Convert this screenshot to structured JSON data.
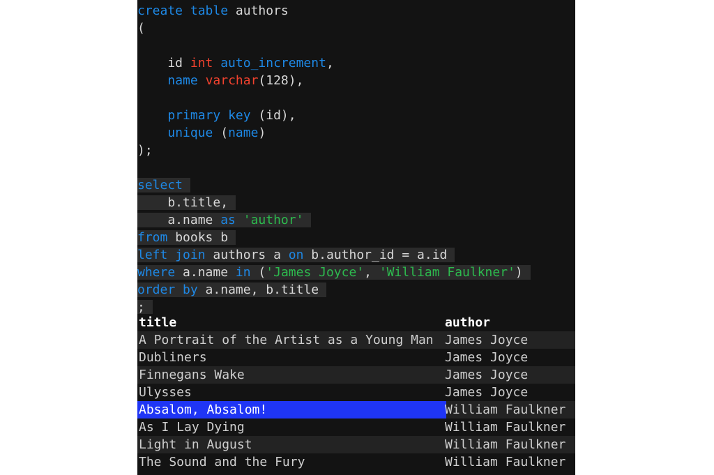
{
  "theme": {
    "page_background": "#ffffff",
    "console_background": "#131313",
    "row_alt_background": "#232323",
    "selection_background": "#2b2b2b",
    "cell_selected_background": "#1f35f5",
    "keyword_color": "#1e88e5",
    "type_color": "#f1422e",
    "string_color": "#2dba4e",
    "plain_text_color": "#d8d8d8",
    "header_text_color": "#ffffff"
  },
  "editor": {
    "lines": [
      {
        "selected": false,
        "tokens": [
          {
            "t": "create",
            "c": "kw"
          },
          {
            "t": " ",
            "c": "pl"
          },
          {
            "t": "table",
            "c": "kw"
          },
          {
            "t": " authors",
            "c": "pl"
          }
        ]
      },
      {
        "selected": false,
        "tokens": [
          {
            "t": "(",
            "c": "pl"
          }
        ]
      },
      {
        "selected": false,
        "tokens": [
          {
            "t": "",
            "c": "pl"
          }
        ]
      },
      {
        "selected": false,
        "tokens": [
          {
            "t": "    id ",
            "c": "pl"
          },
          {
            "t": "int",
            "c": "typ"
          },
          {
            "t": " ",
            "c": "pl"
          },
          {
            "t": "auto_increment",
            "c": "kw"
          },
          {
            "t": ",",
            "c": "pl"
          }
        ]
      },
      {
        "selected": false,
        "tokens": [
          {
            "t": "    ",
            "c": "pl"
          },
          {
            "t": "name",
            "c": "kw"
          },
          {
            "t": " ",
            "c": "pl"
          },
          {
            "t": "varchar",
            "c": "typ"
          },
          {
            "t": "(128),",
            "c": "pl"
          }
        ]
      },
      {
        "selected": false,
        "tokens": [
          {
            "t": "",
            "c": "pl"
          }
        ]
      },
      {
        "selected": false,
        "tokens": [
          {
            "t": "    ",
            "c": "pl"
          },
          {
            "t": "primary",
            "c": "kw"
          },
          {
            "t": " ",
            "c": "pl"
          },
          {
            "t": "key",
            "c": "kw"
          },
          {
            "t": " (id),",
            "c": "pl"
          }
        ]
      },
      {
        "selected": false,
        "tokens": [
          {
            "t": "    ",
            "c": "pl"
          },
          {
            "t": "unique",
            "c": "kw"
          },
          {
            "t": " (",
            "c": "pl"
          },
          {
            "t": "name",
            "c": "kw"
          },
          {
            "t": ")",
            "c": "pl"
          }
        ]
      },
      {
        "selected": false,
        "tokens": [
          {
            "t": ");",
            "c": "pl"
          }
        ]
      },
      {
        "selected": false,
        "tokens": [
          {
            "t": "",
            "c": "pl"
          }
        ]
      },
      {
        "selected": true,
        "tokens": [
          {
            "t": "select",
            "c": "kw"
          }
        ]
      },
      {
        "selected": true,
        "tokens": [
          {
            "t": "    b.title,",
            "c": "pl"
          }
        ]
      },
      {
        "selected": true,
        "tokens": [
          {
            "t": "    a.name ",
            "c": "pl"
          },
          {
            "t": "as",
            "c": "kw"
          },
          {
            "t": " ",
            "c": "pl"
          },
          {
            "t": "'author'",
            "c": "str"
          }
        ]
      },
      {
        "selected": true,
        "tokens": [
          {
            "t": "from",
            "c": "kw"
          },
          {
            "t": " books b",
            "c": "pl"
          }
        ]
      },
      {
        "selected": true,
        "tokens": [
          {
            "t": "left",
            "c": "kw"
          },
          {
            "t": " ",
            "c": "pl"
          },
          {
            "t": "join",
            "c": "kw"
          },
          {
            "t": " authors a ",
            "c": "pl"
          },
          {
            "t": "on",
            "c": "kw"
          },
          {
            "t": " b.author_id = a.id",
            "c": "pl"
          }
        ]
      },
      {
        "selected": true,
        "tokens": [
          {
            "t": "where",
            "c": "kw"
          },
          {
            "t": " a.name ",
            "c": "pl"
          },
          {
            "t": "in",
            "c": "kw"
          },
          {
            "t": " (",
            "c": "pl"
          },
          {
            "t": "'James Joyce'",
            "c": "str"
          },
          {
            "t": ", ",
            "c": "pl"
          },
          {
            "t": "'William Faulkner'",
            "c": "str"
          },
          {
            "t": ")",
            "c": "pl"
          }
        ]
      },
      {
        "selected": true,
        "tokens": [
          {
            "t": "order",
            "c": "kw"
          },
          {
            "t": " ",
            "c": "pl"
          },
          {
            "t": "by",
            "c": "kw"
          },
          {
            "t": " a.name, b.title",
            "c": "pl"
          }
        ]
      },
      {
        "selected": true,
        "tokens": [
          {
            "t": ";",
            "c": "pl"
          }
        ]
      }
    ]
  },
  "results": {
    "columns": [
      "title",
      "author"
    ],
    "rows": [
      {
        "title": "A Portrait of the Artist as a Young Man",
        "author": "James Joyce",
        "selected_cell": null
      },
      {
        "title": "Dubliners",
        "author": "James Joyce",
        "selected_cell": null
      },
      {
        "title": "Finnegans Wake",
        "author": "James Joyce",
        "selected_cell": null
      },
      {
        "title": "Ulysses",
        "author": "James Joyce",
        "selected_cell": null
      },
      {
        "title": "Absalom, Absalom!",
        "author": "William Faulkner",
        "selected_cell": "title"
      },
      {
        "title": "As I Lay Dying",
        "author": "William Faulkner",
        "selected_cell": null
      },
      {
        "title": "Light in August",
        "author": "William Faulkner",
        "selected_cell": null
      },
      {
        "title": "The Sound and the Fury",
        "author": "William Faulkner",
        "selected_cell": null
      }
    ]
  }
}
